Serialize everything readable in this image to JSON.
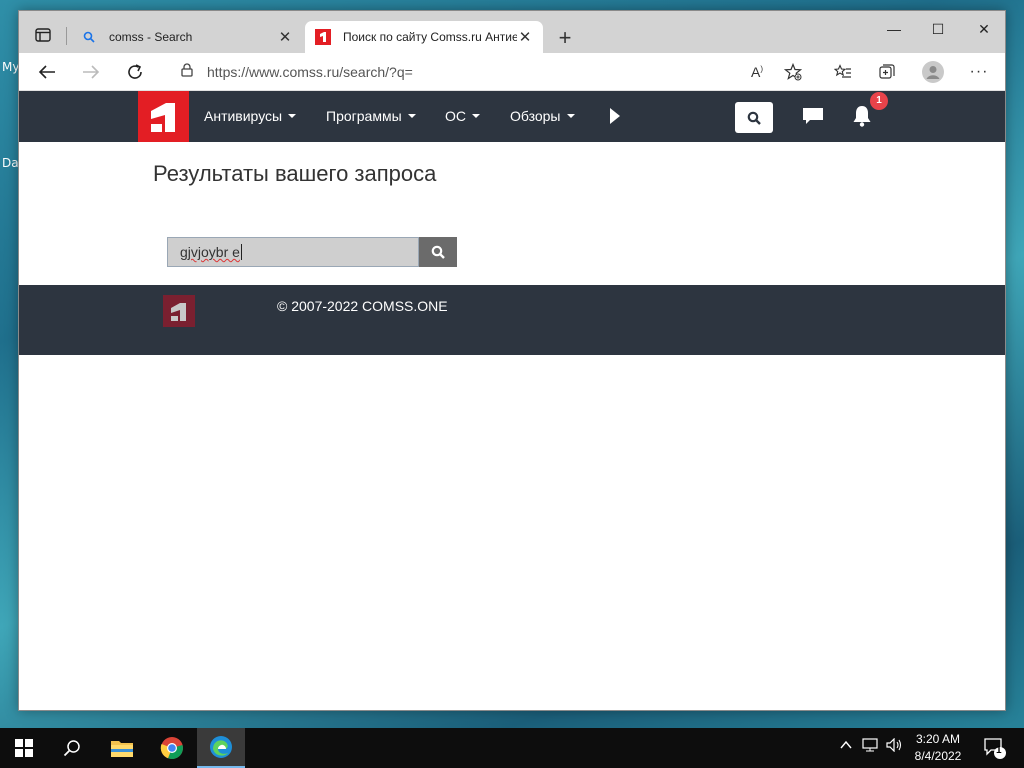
{
  "desktop": {
    "labels": [
      "My",
      "Da"
    ]
  },
  "browser": {
    "tabs": [
      {
        "title": "comss - Search",
        "icon": "search-icon"
      },
      {
        "title": "Поиск по сайту Comss.ru Антие",
        "icon": "comss-favicon"
      }
    ],
    "new_tab": "+",
    "url": "https://www.comss.ru/search/?q=",
    "window_controls": {
      "minimize": "—",
      "maximize": "☐",
      "close": "✕"
    },
    "toolbar_icons": [
      "back-icon",
      "forward-icon",
      "refresh-icon",
      "lock-icon",
      "read-aloud-icon",
      "add-favorite-icon",
      "favorites-icon",
      "collections-icon",
      "profile-icon",
      "more-icon"
    ]
  },
  "site": {
    "nav": {
      "items": [
        "Антивирусы",
        "Программы",
        "ОС",
        "Обзоры"
      ],
      "notification_count": "1"
    },
    "page_title": "Результаты вашего запроса",
    "search": {
      "value": "gjvjoybr е"
    },
    "footer": {
      "copyright": "© 2007-2022 COMSS.ONE"
    },
    "colors": {
      "brand_red": "#e31e24",
      "nav_bg": "#2d3540",
      "badge": "#e8434a"
    }
  },
  "taskbar": {
    "clock_time": "3:20 AM",
    "clock_date": "8/4/2022",
    "notification_count": "1"
  }
}
